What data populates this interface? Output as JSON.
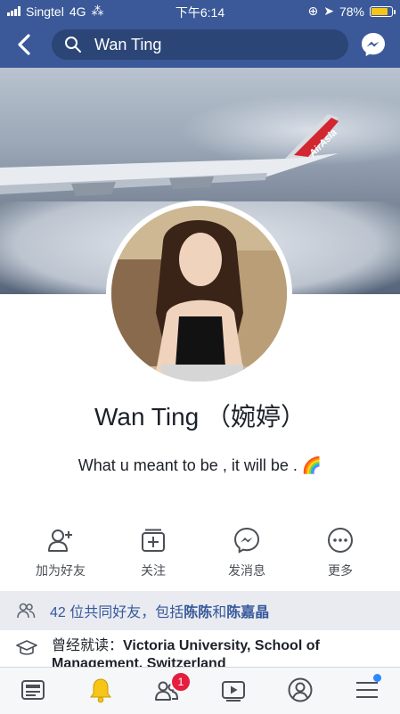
{
  "status": {
    "carrier": "Singtel",
    "network": "4G",
    "time": "下午6:14",
    "battery": "78%",
    "battery_level": 0.78,
    "battery_color": "#f5c518"
  },
  "search": {
    "query": "Wan Ting"
  },
  "profile": {
    "name": "Wan Ting （婉婷）",
    "bio": "What u meant to be , it will be . 🌈"
  },
  "actions": [
    {
      "label": "加为好友",
      "icon": "add-friend-icon"
    },
    {
      "label": "关注",
      "icon": "follow-icon"
    },
    {
      "label": "发消息",
      "icon": "messenger-icon"
    },
    {
      "label": "更多",
      "icon": "more-icon"
    }
  ],
  "mutual": {
    "prefix": "42 位共同好友，包括",
    "friend1": "陈陈",
    "joiner": "和",
    "friend2": "陈嘉晶"
  },
  "education": {
    "prefix": "曾经就读：",
    "school": "Victoria University, School of Management, Switzerland"
  },
  "tabbar": {
    "notifications_badge": "1"
  },
  "colors": {
    "brand": "#3b5998",
    "accent_bell": "#f5c518",
    "badge": "#e41e3f",
    "link": "#365899"
  }
}
